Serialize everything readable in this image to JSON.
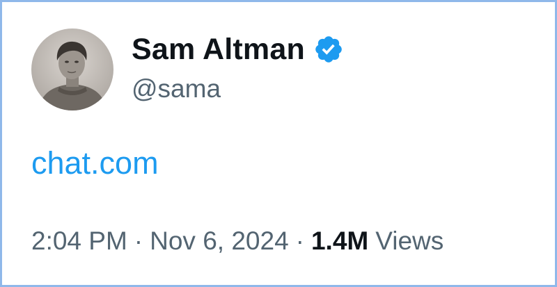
{
  "author": {
    "display_name": "Sam Altman",
    "handle": "@sama",
    "verified": true,
    "verified_icon": "verified-badge-icon",
    "avatar": "profile-photo"
  },
  "tweet": {
    "link_text": "chat.com"
  },
  "meta": {
    "time": "2:04 PM",
    "separator": "·",
    "date": "Nov 6, 2024",
    "views_count": "1.4M",
    "views_label": "Views"
  },
  "colors": {
    "link": "#1d9bf0",
    "secondary_text": "#536471",
    "primary_text": "#0f1419",
    "verified": "#1d9bf0",
    "frame_border": "#8fb8ea"
  }
}
